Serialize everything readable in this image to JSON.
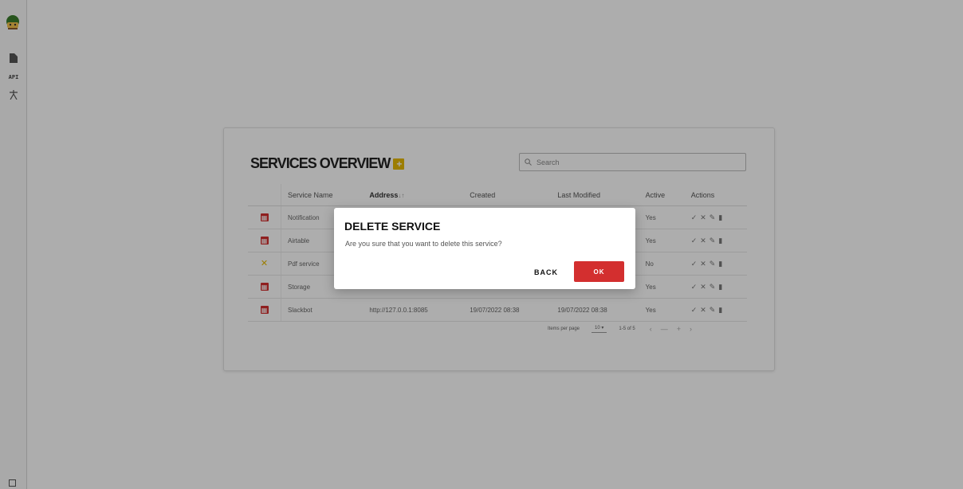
{
  "sidebar": {
    "items": [
      {
        "icon": "document-icon"
      },
      {
        "icon": "api-icon",
        "label": "API"
      },
      {
        "icon": "person-icon"
      }
    ]
  },
  "services": {
    "title": "SERVICES OVERVIEW",
    "add_label": "+",
    "search_placeholder": "Search",
    "columns": [
      "Service Name",
      "Address",
      "Created",
      "Last Modified",
      "Active",
      "Actions"
    ],
    "sort_indicator": "↓↑",
    "rows": [
      {
        "icon": "box-icon",
        "name": "Notification",
        "address": "",
        "created": "",
        "modified": "",
        "active": "Yes"
      },
      {
        "icon": "box-icon",
        "name": "Airtable",
        "address": "",
        "created": "",
        "modified": "",
        "active": "Yes"
      },
      {
        "icon": "tools-icon",
        "name": "Pdf service",
        "address": "",
        "created": "",
        "modified": "",
        "active": "No"
      },
      {
        "icon": "box-icon",
        "name": "Storage",
        "address": "",
        "created": "",
        "modified": "",
        "active": "Yes"
      },
      {
        "icon": "box-icon",
        "name": "Slackbot",
        "address": "http://127.0.0.1:8085",
        "created": "19/07/2022 08:38",
        "modified": "19/07/2022 08:38",
        "active": "Yes"
      }
    ],
    "actions": {
      "check": "✓",
      "close": "✕",
      "edit": "✎",
      "delete": "🗑"
    },
    "paginator": {
      "items_per_page_label": "Items per page",
      "page_size": "10",
      "range": "1-5 of 5",
      "nav": [
        "|<",
        "<",
        ">",
        ">|"
      ]
    }
  },
  "dialog": {
    "title": "DELETE SERVICE",
    "message": "Are you sure that you want to delete this service?",
    "back_label": "BACK",
    "ok_label": "OK"
  },
  "colors": {
    "accent": "#d32f2f",
    "add": "#e6b800"
  }
}
